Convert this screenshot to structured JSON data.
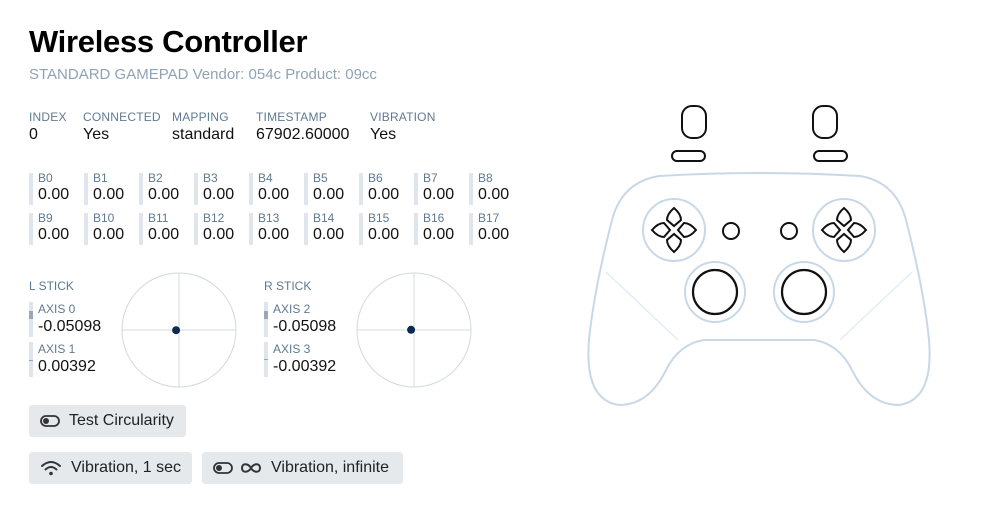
{
  "header": {
    "title": "Wireless Controller",
    "subtitle": "STANDARD GAMEPAD Vendor: 054c Product: 09cc"
  },
  "info": [
    {
      "label": "INDEX",
      "value": "0"
    },
    {
      "label": "CONNECTED",
      "value": "Yes"
    },
    {
      "label": "MAPPING",
      "value": "standard"
    },
    {
      "label": "TIMESTAMP",
      "value": "67902.60000"
    },
    {
      "label": "VIBRATION",
      "value": "Yes"
    }
  ],
  "buttons": [
    {
      "label": "B0",
      "value": "0.00"
    },
    {
      "label": "B1",
      "value": "0.00"
    },
    {
      "label": "B2",
      "value": "0.00"
    },
    {
      "label": "B3",
      "value": "0.00"
    },
    {
      "label": "B4",
      "value": "0.00"
    },
    {
      "label": "B5",
      "value": "0.00"
    },
    {
      "label": "B6",
      "value": "0.00"
    },
    {
      "label": "B7",
      "value": "0.00"
    },
    {
      "label": "B8",
      "value": "0.00"
    },
    {
      "label": "B9",
      "value": "0.00"
    },
    {
      "label": "B10",
      "value": "0.00"
    },
    {
      "label": "B11",
      "value": "0.00"
    },
    {
      "label": "B12",
      "value": "0.00"
    },
    {
      "label": "B13",
      "value": "0.00"
    },
    {
      "label": "B14",
      "value": "0.00"
    },
    {
      "label": "B15",
      "value": "0.00"
    },
    {
      "label": "B16",
      "value": "0.00"
    },
    {
      "label": "B17",
      "value": "0.00"
    }
  ],
  "sticks": {
    "left": {
      "title": "L STICK",
      "axes": [
        {
          "label": "AXIS 0",
          "value": "-0.05098"
        },
        {
          "label": "AXIS 1",
          "value": "0.00392"
        }
      ],
      "x": -0.05098,
      "y": 0.00392
    },
    "right": {
      "title": "R STICK",
      "axes": [
        {
          "label": "AXIS 2",
          "value": "-0.05098"
        },
        {
          "label": "AXIS 3",
          "value": "-0.00392"
        }
      ],
      "x": -0.05098,
      "y": -0.00392
    }
  },
  "actions": {
    "circularity": {
      "label": "Test Circularity",
      "icon": "toggle-icon"
    },
    "vibration_1s": {
      "label": "Vibration, 1 sec",
      "icon": "wifi-icon"
    },
    "vibration_inf": {
      "label": "Vibration, infinite",
      "icon": "infinity-icon"
    }
  },
  "colors": {
    "accent_dot": "#0d2b4e",
    "controller_outline": "#c8d8e6",
    "button_bg": "#e6e9ec",
    "label": "#5f7a91",
    "subtitle": "#8fa3b5"
  }
}
